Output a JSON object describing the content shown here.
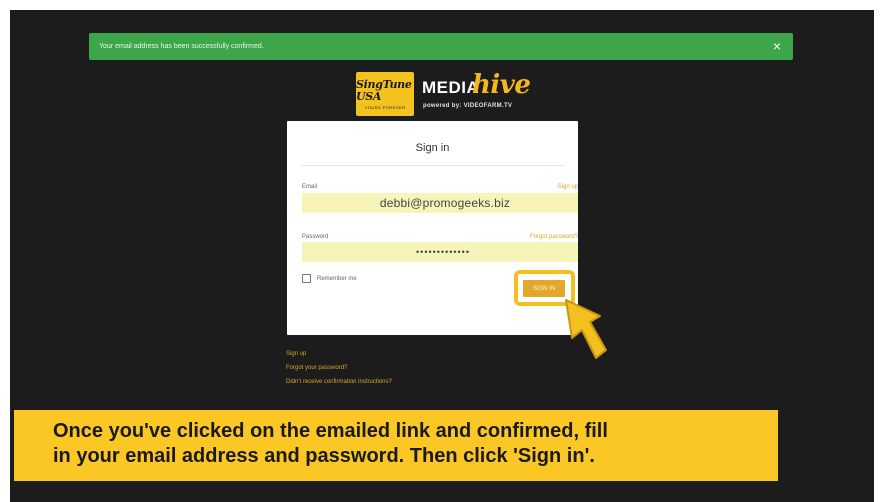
{
  "flash": {
    "message": "Your email address has been successfully confirmed.",
    "close_glyph": "×",
    "color": "#3ea64a"
  },
  "logo": {
    "badge_main": "SingTune USA",
    "badge_sub": "YOURS FOREVER",
    "media": "MEDIA",
    "hive": "hive",
    "powered": "powered by: VIDEOFARM.TV"
  },
  "signin": {
    "title": "Sign in",
    "email_label": "Email",
    "signup_link": "Sign up",
    "email_value": "debbi@promogeeks.biz",
    "password_label": "Password",
    "forgot_link": "Forgot password?",
    "password_value": "•••••••••••••",
    "remember_label": "Remember me",
    "button_label": "SIGN IN",
    "accent": "#e2a72d"
  },
  "bottom_links": {
    "signup": "Sign up",
    "forgot": "Forgot your password?",
    "confirm": "Didn't receive confirmation instructions?"
  },
  "caption": {
    "line1": "Once you've clicked on the emailed link and confirmed, fill",
    "line2": "in your email address and password. Then click 'Sign in'.",
    "color": "#fbc725"
  }
}
